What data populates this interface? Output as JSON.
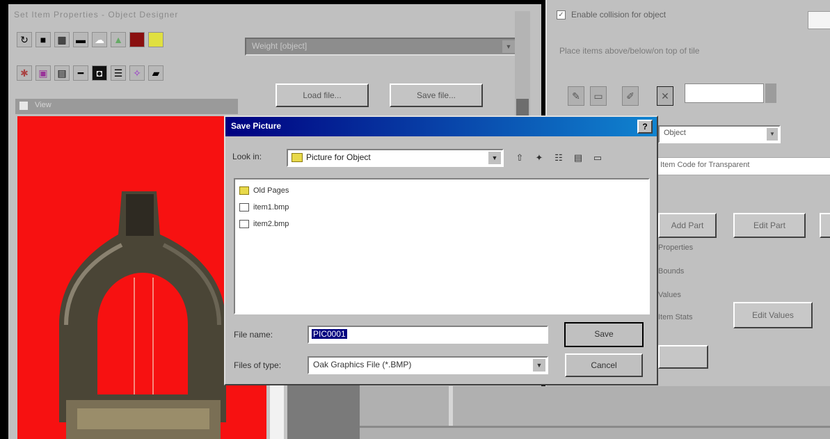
{
  "app": {
    "title": "Set Item Properties - Object Designer",
    "load_button": "Load file...",
    "save_button": "Save file...",
    "combo_value": "Weight [object]",
    "strip_text": "View"
  },
  "toolbar": {
    "row1": [
      "open-icon",
      "save-icon",
      "grid-icon",
      "key-icon",
      "cloud-icon",
      "paint-icon",
      "brush-icon",
      "bulb-icon"
    ],
    "row2": [
      "rotate-icon",
      "box-icon",
      "grid2-icon",
      "line-icon",
      "dark-square-icon",
      "list-icon",
      "star-icon",
      "image-icon"
    ]
  },
  "properties": {
    "checkbox_label": "Enable collision for object",
    "checkbox_checked": true,
    "description": "Place items above/below/on top of tile",
    "select_value": "Object",
    "field_value": "Item Code for Transparent",
    "btn_add": "Add Part",
    "btn_edit": "Edit Part",
    "label_a": "Properties",
    "label_b": "Bounds",
    "label_c": "Values",
    "label_d": "Item Stats",
    "edit_values": "Edit Values"
  },
  "dialog": {
    "title": "Save Picture",
    "look_in_label": "Look in:",
    "look_in_value": "Picture for Object",
    "files": [
      {
        "name": "Old Pages",
        "kind": "folder"
      },
      {
        "name": "item1.bmp",
        "kind": "file"
      },
      {
        "name": "item2.bmp",
        "kind": "file"
      }
    ],
    "file_name_label": "File name:",
    "file_name_value": "PIC0001",
    "file_type_label": "Files of type:",
    "file_type_value": "Oak Graphics File (*.BMP)",
    "save_button": "Save",
    "cancel_button": "Cancel",
    "close_glyph": "?",
    "colors": {
      "titlebar_start": "#000080",
      "titlebar_end": "#1084d0"
    }
  },
  "canvas": {
    "background": "#f71111"
  }
}
